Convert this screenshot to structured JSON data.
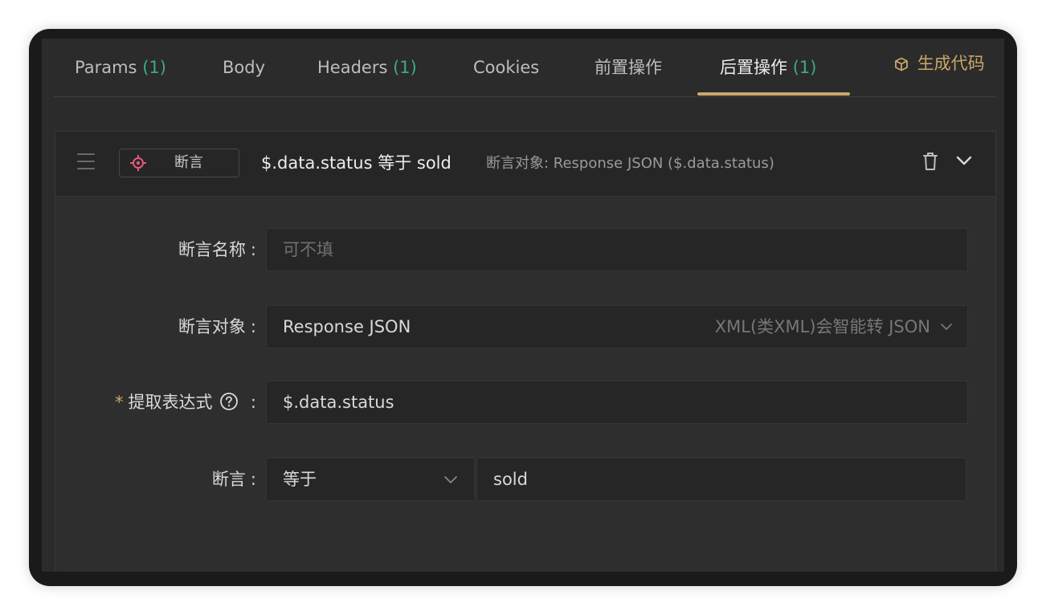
{
  "tabs": [
    {
      "label": "Params",
      "count": "(1)"
    },
    {
      "label": "Body",
      "count": ""
    },
    {
      "label": "Headers",
      "count": "(1)"
    },
    {
      "label": "Cookies",
      "count": ""
    },
    {
      "label": "前置操作",
      "count": ""
    },
    {
      "label": "后置操作",
      "count": "(1)",
      "active": true
    }
  ],
  "generate_code_label": "生成代码",
  "assertion": {
    "type_label": "断言",
    "title": "$.data.status 等于 sold",
    "subtitle": "断言对象: Response JSON ($.data.status)",
    "form": {
      "name_label": "断言名称",
      "name_placeholder": "可不填",
      "name_value": "",
      "target_label": "断言对象",
      "target_value": "Response JSON",
      "target_hint": "XML(类XML)会智能转 JSON",
      "expr_required_mark": "*",
      "expr_label": "提取表达式",
      "expr_value": "$.data.status",
      "assert_label": "断言",
      "operator_value": "等于",
      "expected_value": "sold",
      "colon": ":"
    }
  },
  "colors": {
    "accent": "#c9a76a",
    "count": "#3ea88a",
    "crosshair": "#e05a7a",
    "background": "#2b2b2b"
  },
  "icons": [
    "cube-icon",
    "crosshair-icon",
    "trash-icon",
    "chevron-down-icon",
    "help-icon",
    "drag-handle-icon"
  ]
}
